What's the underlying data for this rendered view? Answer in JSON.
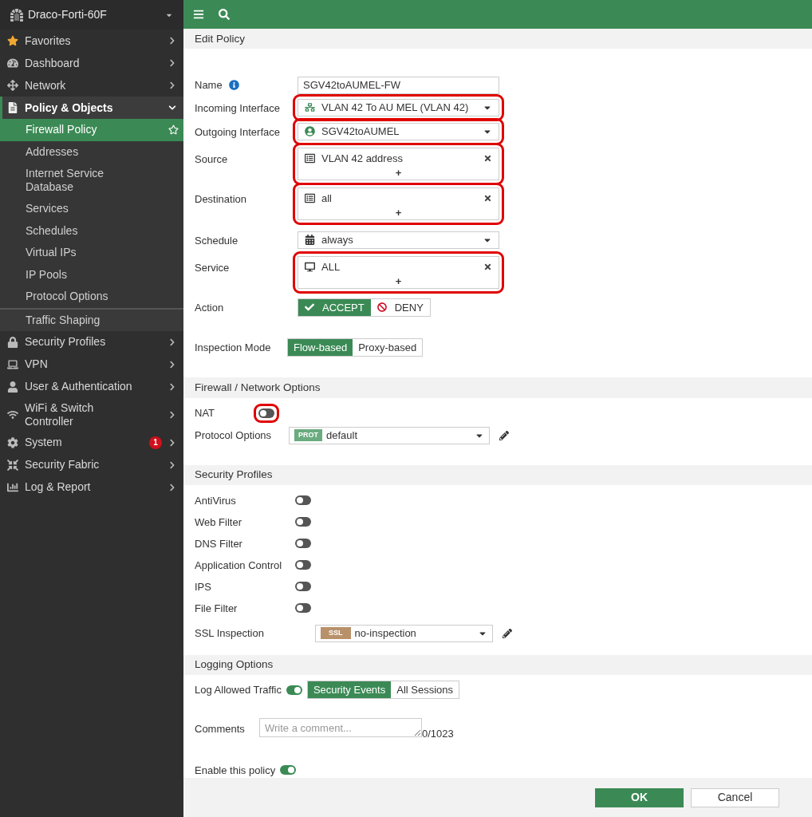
{
  "sidebar": {
    "device": "Draco-Forti-60F",
    "items": [
      {
        "label": "Favorites",
        "expanded": false
      },
      {
        "label": "Dashboard",
        "expanded": false
      },
      {
        "label": "Network",
        "expanded": false
      },
      {
        "label": "Policy & Objects",
        "expanded": true,
        "children": [
          {
            "label": "Firewall Policy",
            "selected": true
          },
          {
            "label": "Addresses",
            "selected": false
          },
          {
            "label": "Internet Service Database",
            "selected": false
          },
          {
            "label": "Services",
            "selected": false
          },
          {
            "label": "Schedules",
            "selected": false
          },
          {
            "label": "Virtual IPs",
            "selected": false
          },
          {
            "label": "IP Pools",
            "selected": false
          },
          {
            "label": "Protocol Options",
            "selected": false
          },
          {
            "label": "Traffic Shaping",
            "selected": false
          }
        ]
      },
      {
        "label": "Security Profiles",
        "expanded": false
      },
      {
        "label": "VPN",
        "expanded": false
      },
      {
        "label": "User & Authentication",
        "expanded": false
      },
      {
        "label": "WiFi & Switch Controller",
        "expanded": false
      },
      {
        "label": "System",
        "expanded": false,
        "badge": "1"
      },
      {
        "label": "Security Fabric",
        "expanded": false
      },
      {
        "label": "Log & Report",
        "expanded": false
      }
    ]
  },
  "edit_policy": {
    "title": "Edit Policy",
    "fields": [
      {
        "kind": "text",
        "label": "Name",
        "value": "SGV42toAUMEL-FW",
        "highlighted": false
      },
      {
        "kind": "select",
        "label": "Incoming Interface",
        "value": "VLAN 42 To AU MEL (VLAN 42)",
        "highlighted": true
      },
      {
        "kind": "select",
        "label": "Outgoing Interface",
        "value": "SGV42toAUMEL",
        "highlighted": true
      },
      {
        "kind": "multi",
        "label": "Source",
        "entries": [
          "VLAN 42 address"
        ],
        "add": "+",
        "highlighted": true
      },
      {
        "kind": "multi",
        "label": "Destination",
        "entries": [
          "all"
        ],
        "add": "+",
        "highlighted": true
      },
      {
        "kind": "select",
        "label": "Schedule",
        "value": "always",
        "highlighted": false
      },
      {
        "kind": "multi",
        "label": "Service",
        "entries": [
          "ALL"
        ],
        "add": "+",
        "highlighted": true
      },
      {
        "kind": "action",
        "label": "Action",
        "options": [
          {
            "label": "ACCEPT",
            "selected": true
          },
          {
            "label": "DENY",
            "selected": false
          }
        ]
      },
      {
        "kind": "mode",
        "label": "Inspection Mode",
        "options": [
          {
            "label": "Flow-based",
            "selected": true
          },
          {
            "label": "Proxy-based",
            "selected": false
          }
        ]
      }
    ]
  },
  "firewall_options": {
    "title": "Firewall / Network Options",
    "nat": {
      "label": "NAT",
      "on": false,
      "highlighted": true
    },
    "protocol_options": {
      "label": "Protocol Options",
      "tag": "PROT",
      "value": "default"
    }
  },
  "security_profiles": {
    "title": "Security Profiles",
    "toggles": [
      {
        "label": "AntiVirus",
        "on": false
      },
      {
        "label": "Web Filter",
        "on": false
      },
      {
        "label": "DNS Filter",
        "on": false
      },
      {
        "label": "Application Control",
        "on": false
      },
      {
        "label": "IPS",
        "on": false
      },
      {
        "label": "File Filter",
        "on": false
      }
    ],
    "ssl_inspection": {
      "label": "SSL Inspection",
      "tag": "SSL",
      "value": "no-inspection"
    }
  },
  "logging_options": {
    "title": "Logging Options",
    "log_allowed": {
      "label": "Log Allowed Traffic",
      "on": true,
      "options": [
        {
          "label": "Security Events",
          "selected": true
        },
        {
          "label": "All Sessions",
          "selected": false
        }
      ]
    },
    "comments": {
      "label": "Comments",
      "placeholder": "Write a comment...",
      "counter": "0/1023"
    },
    "enable": {
      "label": "Enable this policy",
      "on": true
    }
  },
  "footer": {
    "buttons": [
      {
        "label": "OK",
        "kind": "primary"
      },
      {
        "label": "Cancel",
        "kind": "secondary"
      }
    ]
  }
}
